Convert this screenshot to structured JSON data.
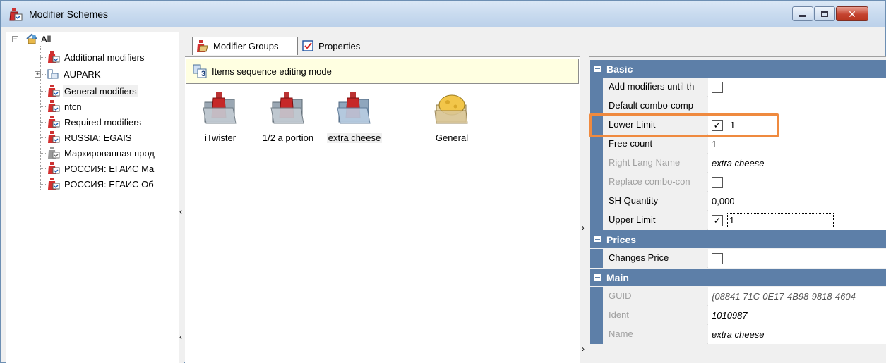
{
  "window": {
    "title": "Modifier Schemes",
    "icon": "ketchup-bottle-icon",
    "buttons": [
      "minimize",
      "maximize",
      "close"
    ]
  },
  "tree": {
    "root": "All",
    "items": [
      {
        "label": "Additional modifiers",
        "icon": "ketchup-bottle-icon"
      },
      {
        "label": "AUPARK",
        "icon": "group-folder-icon",
        "expandable": true
      },
      {
        "label": "General modifiers",
        "icon": "ketchup-bottle-icon",
        "selected": true
      },
      {
        "label": "ntcn",
        "icon": "ketchup-bottle-icon"
      },
      {
        "label": "Required modifiers",
        "icon": "ketchup-bottle-icon"
      },
      {
        "label": "RUSSIA: EGAIS",
        "icon": "ketchup-bottle-icon"
      },
      {
        "label": "Маркированная прод",
        "icon": "grey-bottle-icon"
      },
      {
        "label": "РОССИЯ: ЕГАИС Ма",
        "icon": "ketchup-bottle-icon"
      },
      {
        "label": "РОССИЯ: ЕГАИС Об",
        "icon": "ketchup-bottle-icon"
      }
    ]
  },
  "tabs": [
    {
      "label": "Modifier Groups",
      "icon": "ketchup-bottle-icon",
      "active": true
    },
    {
      "label": "Properties",
      "icon": "properties-icon",
      "active": false
    }
  ],
  "sequence_bar": {
    "text": "Items sequence editing mode",
    "icon": "sequence-mode-icon",
    "badge": "3"
  },
  "items": [
    {
      "label": "iTwister",
      "icon": "bottle-folder-icon"
    },
    {
      "label": "1/2 a portion",
      "icon": "bottle-folder-icon"
    },
    {
      "label": "extra cheese",
      "icon": "bottle-folder-icon",
      "selected": true
    },
    {
      "label": "General",
      "icon": "cheese-folder-icon"
    }
  ],
  "properties": {
    "basic_title": "Basic",
    "prices_title": "Prices",
    "main_title": "Main",
    "add_until": {
      "name": "Add modifiers until th",
      "checked": false
    },
    "default_combo": {
      "name": "Default combo-comp",
      "value": ""
    },
    "lower_limit": {
      "name": "Lower Limit",
      "checked": true,
      "value": "1"
    },
    "free_count": {
      "name": "Free count",
      "value": "1"
    },
    "right_lang_name": {
      "name": "Right Lang Name",
      "value": "extra cheese"
    },
    "replace_combo": {
      "name": "Replace combo-con",
      "checked": false
    },
    "sh_quantity": {
      "name": "SH Quantity",
      "value": "0,000"
    },
    "upper_limit": {
      "name": "Upper Limit",
      "checked": true,
      "value": "1"
    },
    "changes_price": {
      "name": "Changes Price",
      "checked": false
    },
    "guid": {
      "name": "GUID",
      "value": "{08841 71C-0E17-4B98-9818-4604"
    },
    "ident": {
      "name": "Ident",
      "value": "1010987"
    },
    "name": {
      "name": "Name",
      "value": "extra cheese"
    }
  },
  "colors": {
    "category_header": "#5d7fa8",
    "highlight": "#ef8a3f",
    "sequence_bar": "#ffffe1"
  }
}
